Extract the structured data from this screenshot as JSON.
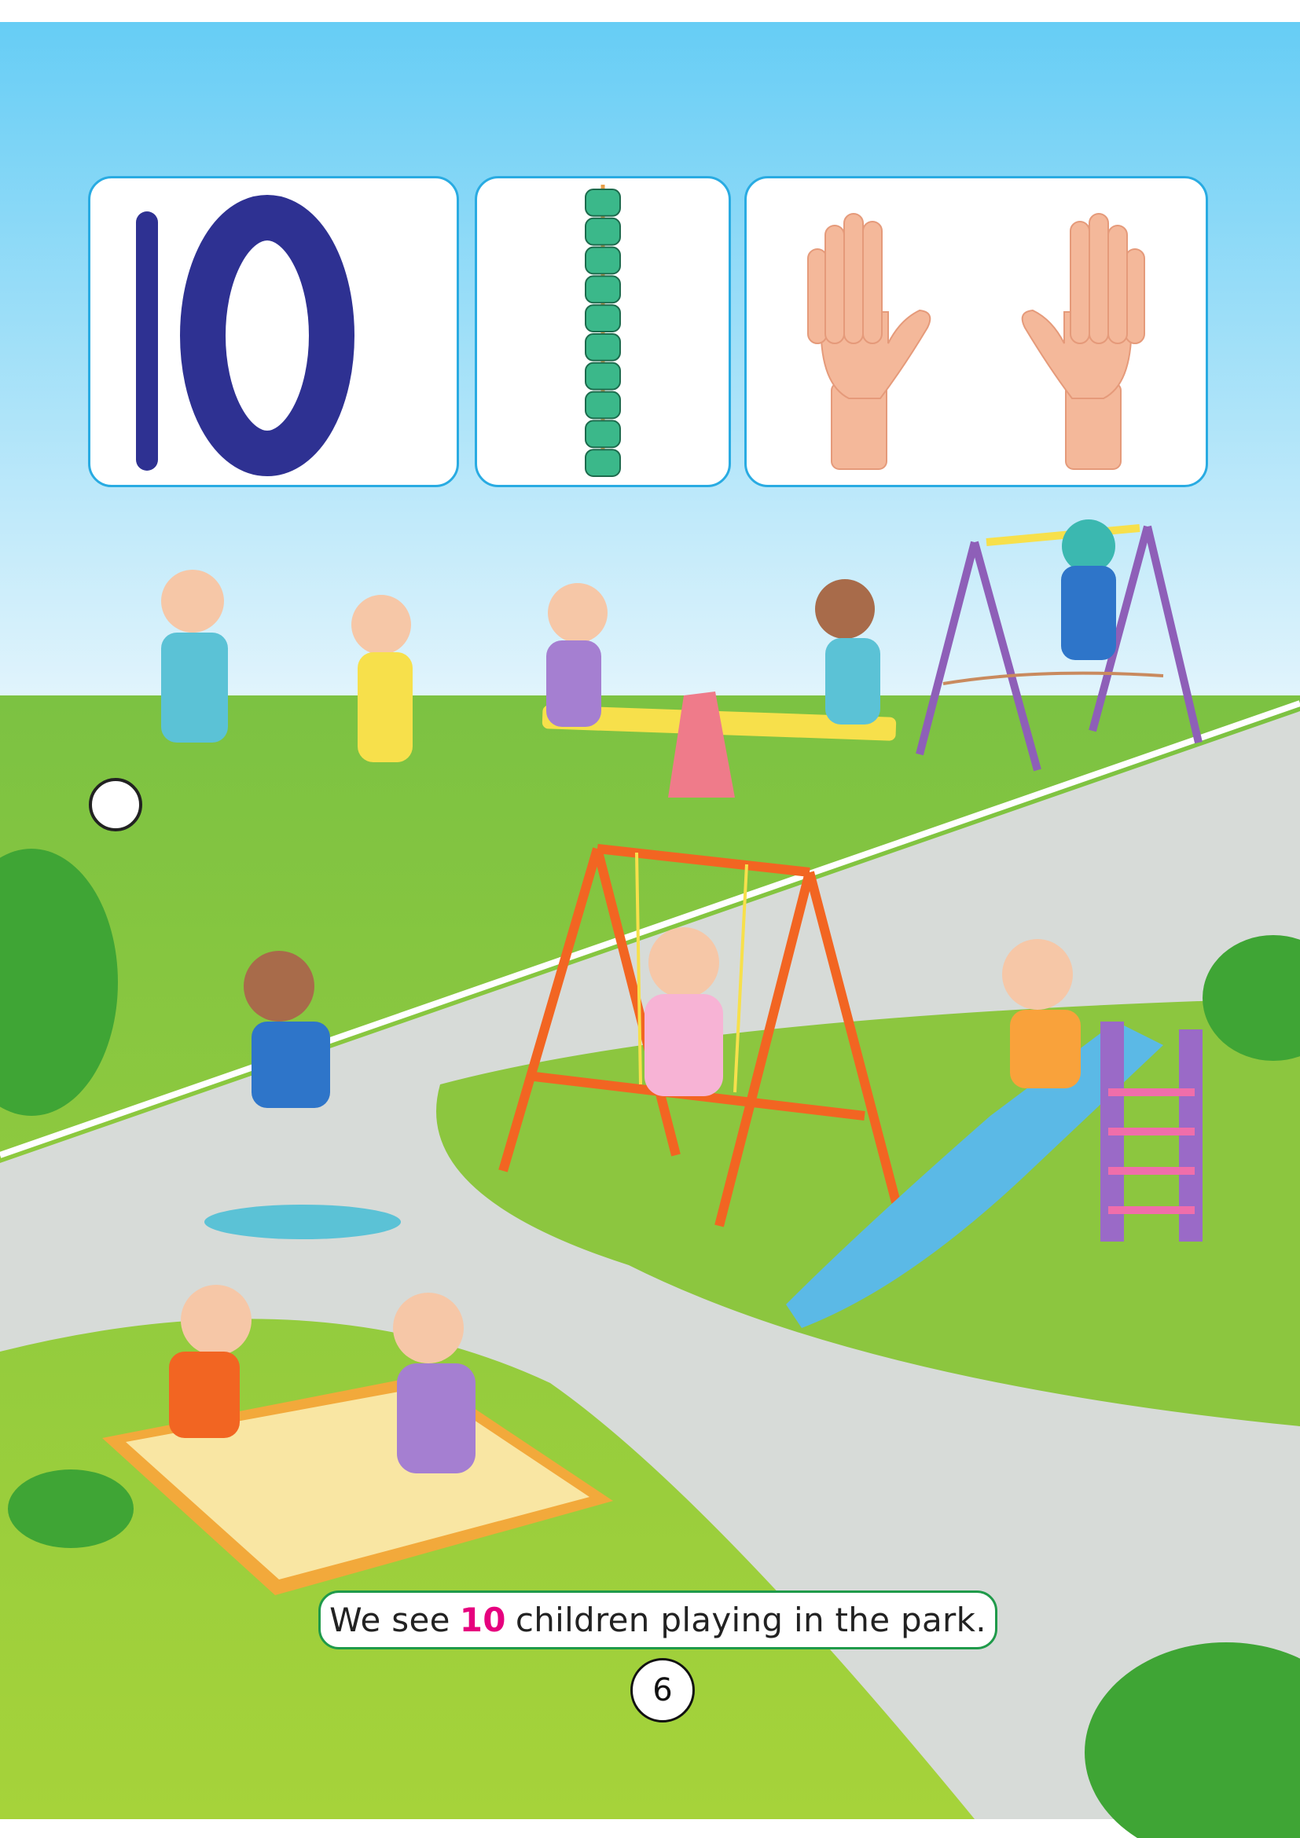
{
  "number_card": {
    "numeral": "10",
    "color": "#2e3192"
  },
  "beads_card": {
    "bead_count": 10,
    "bead_color": "#3bb88a"
  },
  "hands_card": {
    "finger_count": 10,
    "skin_color": "#f4b89a"
  },
  "caption": {
    "before": "We see",
    "number": "10",
    "after": "children playing in the park.",
    "number_color": "#e6007e"
  },
  "page_number": "6",
  "colors": {
    "sky_top": "#66cdf5",
    "sky_bottom": "#e4f5fc",
    "grass": "#8cc63f",
    "road": "#d7dbd8",
    "card_border": "#29abe2",
    "caption_border": "#1f9a4a"
  }
}
